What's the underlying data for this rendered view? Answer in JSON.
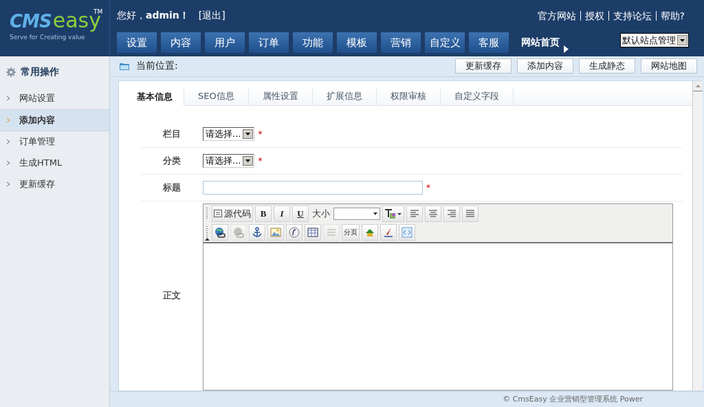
{
  "logo": {
    "mark": "CMS",
    "word": "easy",
    "tm": "TM",
    "tagline": "Serve for Creating value"
  },
  "greeting": "您好，**admin！**",
  "logout": "[退出]",
  "top_links": [
    "官方网站",
    "授权",
    "支持论坛",
    "帮助?"
  ],
  "nav": [
    {
      "label": "设置"
    },
    {
      "label": "内容"
    },
    {
      "label": "用户"
    },
    {
      "label": "订单"
    },
    {
      "label": "功能"
    },
    {
      "label": "模板"
    },
    {
      "label": "营销"
    },
    {
      "label": "自定义"
    },
    {
      "label": "客服"
    }
  ],
  "home_link": "网站首页",
  "site_select": {
    "value": "默认站点管理"
  },
  "sidebar": {
    "title": "常用操作",
    "items": [
      {
        "label": "网站设置",
        "selected": false
      },
      {
        "label": "添加内容",
        "selected": true
      },
      {
        "label": "订单管理",
        "selected": false
      },
      {
        "label": "生成HTML",
        "selected": false
      },
      {
        "label": "更新缓存",
        "selected": false
      }
    ]
  },
  "breadcrumb": "当前位置:",
  "actions": [
    "更新缓存",
    "添加内容",
    "生成静态",
    "网站地图"
  ],
  "tabs": [
    {
      "label": "基本信息",
      "selected": true
    },
    {
      "label": "SEO信息",
      "selected": false
    },
    {
      "label": "属性设置",
      "selected": false
    },
    {
      "label": "扩展信息",
      "selected": false
    },
    {
      "label": "权限审核",
      "selected": false
    },
    {
      "label": "自定义字段",
      "selected": false
    }
  ],
  "form": [
    {
      "label": "栏目",
      "kind": "select",
      "value": "请选择...",
      "mark": "*"
    },
    {
      "label": "分类",
      "kind": "select",
      "value": "请选择...",
      "mark": "*"
    },
    {
      "label": "标题",
      "kind": "text",
      "mark": "*"
    },
    {
      "label": "正文",
      "kind": "editor"
    }
  ],
  "editor": {
    "rows": [
      [
        {
          "kind": "source",
          "label": "源代码"
        },
        {
          "kind": "bold",
          "label": "B"
        },
        {
          "kind": "italic",
          "label": "I"
        },
        {
          "kind": "underline",
          "label": "U"
        },
        {
          "kind": "size",
          "label": "大小"
        },
        {
          "kind": "color"
        },
        {
          "kind": "align"
        },
        {
          "kind": "align"
        },
        {
          "kind": "align"
        },
        {
          "kind": "align"
        }
      ],
      [
        {
          "kind": "icon",
          "disabled": false
        },
        {
          "kind": "icon",
          "disabled": true
        },
        {
          "kind": "icon",
          "disabled": false
        },
        {
          "kind": "icon",
          "disabled": false
        },
        {
          "kind": "icon",
          "disabled": false
        },
        {
          "kind": "icon",
          "disabled": false
        },
        {
          "kind": "icon",
          "disabled": true
        },
        {
          "kind": "text",
          "label": "分页"
        },
        {
          "kind": "icon",
          "disabled": false
        },
        {
          "kind": "icon",
          "disabled": false
        },
        {
          "kind": "icon",
          "disabled": false
        }
      ]
    ]
  },
  "footer": "© CmsEasy 企业营销型管理系统 Power"
}
